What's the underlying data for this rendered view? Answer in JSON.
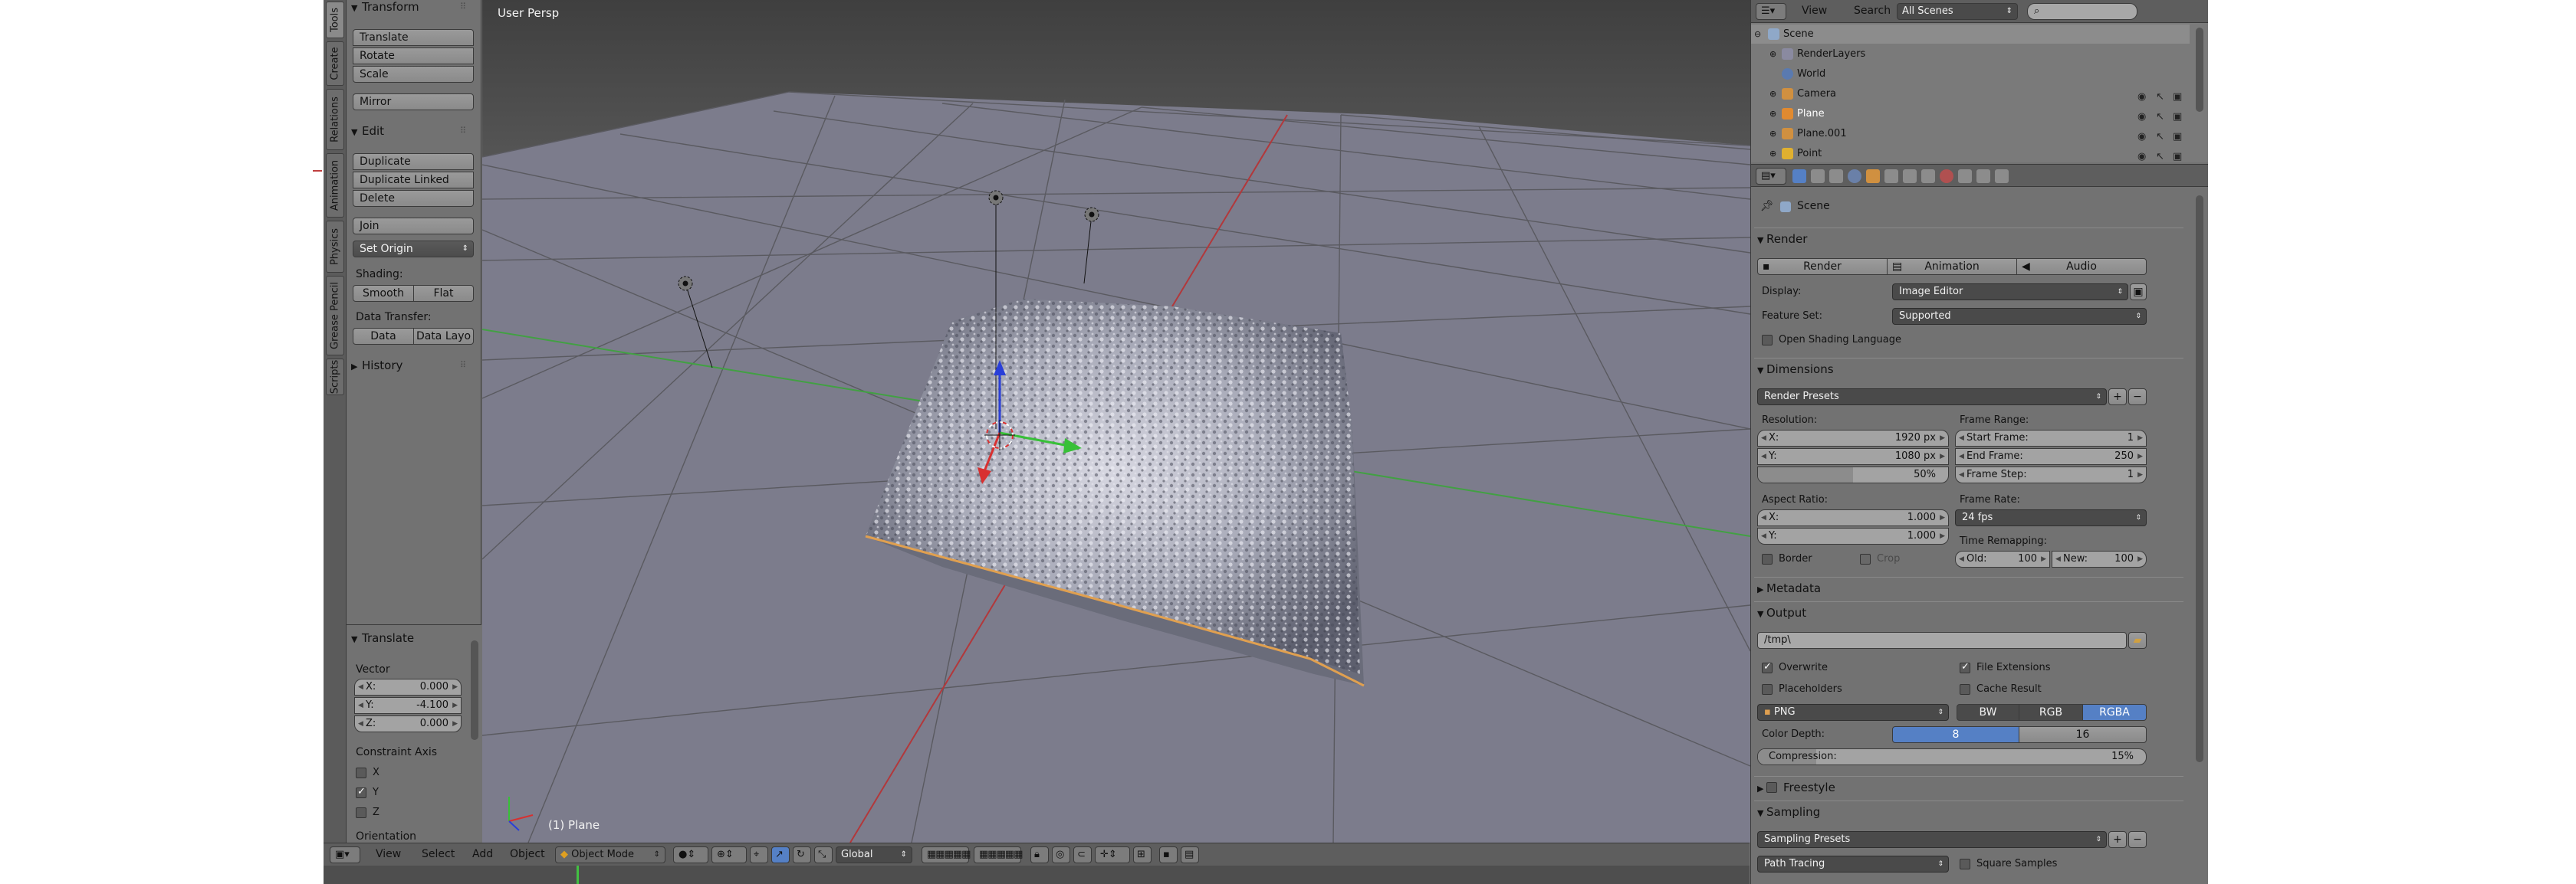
{
  "colors": {
    "viewport_bg": "#7c7c8c",
    "grid_line": "#5a5a60",
    "x_axis": "#b2383b",
    "y_axis": "#42a043",
    "selected_blue": "#5580c5"
  },
  "tool_tabs": [
    "Tools",
    "Create",
    "Relations",
    "Animation",
    "Physics",
    "Grease Pencil",
    "Scripts"
  ],
  "tool_shelf": {
    "transform": {
      "title": "Transform",
      "translate": "Translate",
      "rotate": "Rotate",
      "scale": "Scale",
      "mirror": "Mirror"
    },
    "edit": {
      "title": "Edit",
      "duplicate": "Duplicate",
      "duplicate_linked": "Duplicate Linked",
      "delete": "Delete",
      "join": "Join",
      "set_origin": "Set Origin",
      "shading_label": "Shading:",
      "smooth": "Smooth",
      "flat": "Flat",
      "data_transfer_label": "Data Transfer:",
      "data": "Data",
      "data_layout": "Data Layo"
    },
    "history": "History"
  },
  "operator_panel": {
    "title": "Translate",
    "vector_label": "Vector",
    "x_label": "X:",
    "x_value": "0.000",
    "y_label": "Y:",
    "y_value": "-4.100",
    "z_label": "Z:",
    "z_value": "0.000",
    "constraint_label": "Constraint Axis",
    "cx": "X",
    "cy": "Y",
    "cz": "Z",
    "orientation": "Orientation"
  },
  "viewport": {
    "view_label": "User Persp",
    "object_label": "(1) Plane"
  },
  "view_header": {
    "view": "View",
    "select": "Select",
    "add": "Add",
    "object": "Object",
    "mode": "Object Mode",
    "orientation": "Global"
  },
  "outliner": {
    "view": "View",
    "search": "Search",
    "scenes": "All Scenes",
    "items": [
      {
        "name": "Scene"
      },
      {
        "name": "RenderLayers"
      },
      {
        "name": "World"
      },
      {
        "name": "Camera"
      },
      {
        "name": "Plane"
      },
      {
        "name": "Plane.001"
      },
      {
        "name": "Point"
      }
    ]
  },
  "properties": {
    "context": "Scene",
    "render": {
      "title": "Render",
      "render_btn": "Render",
      "animation_btn": "Animation",
      "audio_btn": "Audio",
      "display_label": "Display:",
      "display_value": "Image Editor",
      "feature_label": "Feature Set:",
      "feature_value": "Supported",
      "osl_label": "Open Shading Language"
    },
    "dimensions": {
      "title": "Dimensions",
      "presets": "Render Presets",
      "resolution_label": "Resolution:",
      "res_x_label": "X:",
      "res_x": "1920 px",
      "res_y_label": "Y:",
      "res_y": "1080 px",
      "res_pct": "50%",
      "res_pct_value": 0.5,
      "frame_range_label": "Frame Range:",
      "start_label": "Start Frame:",
      "start": "1",
      "end_label": "End Frame:",
      "end": "250",
      "step_label": "Frame Step:",
      "step": "1",
      "aspect_label": "Aspect Ratio:",
      "asp_x_label": "X:",
      "asp_x": "1.000",
      "asp_y_label": "Y:",
      "asp_y": "1.000",
      "frame_rate_label": "Frame Rate:",
      "fps": "24 fps",
      "time_remap_label": "Time Remapping:",
      "old_label": "Old:",
      "old": "100",
      "new_label": "New:",
      "new": "100",
      "border": "Border",
      "crop": "Crop"
    },
    "metadata": {
      "title": "Metadata"
    },
    "output": {
      "title": "Output",
      "path": "/tmp\\",
      "overwrite": "Overwrite",
      "file_extensions": "File Extensions",
      "placeholders": "Placeholders",
      "cache_result": "Cache Result",
      "format": "PNG",
      "bw": "BW",
      "rgb": "RGB",
      "rgba": "RGBA",
      "color_depth_label": "Color Depth:",
      "depth_8": "8",
      "depth_16": "16",
      "compression_label": "Compression:",
      "compression": "15%",
      "compression_value": 0.15
    },
    "freestyle": {
      "title": "Freestyle"
    },
    "sampling": {
      "title": "Sampling",
      "presets": "Sampling Presets",
      "integrator": "Path Tracing",
      "square_samples": "Square Samples"
    }
  }
}
